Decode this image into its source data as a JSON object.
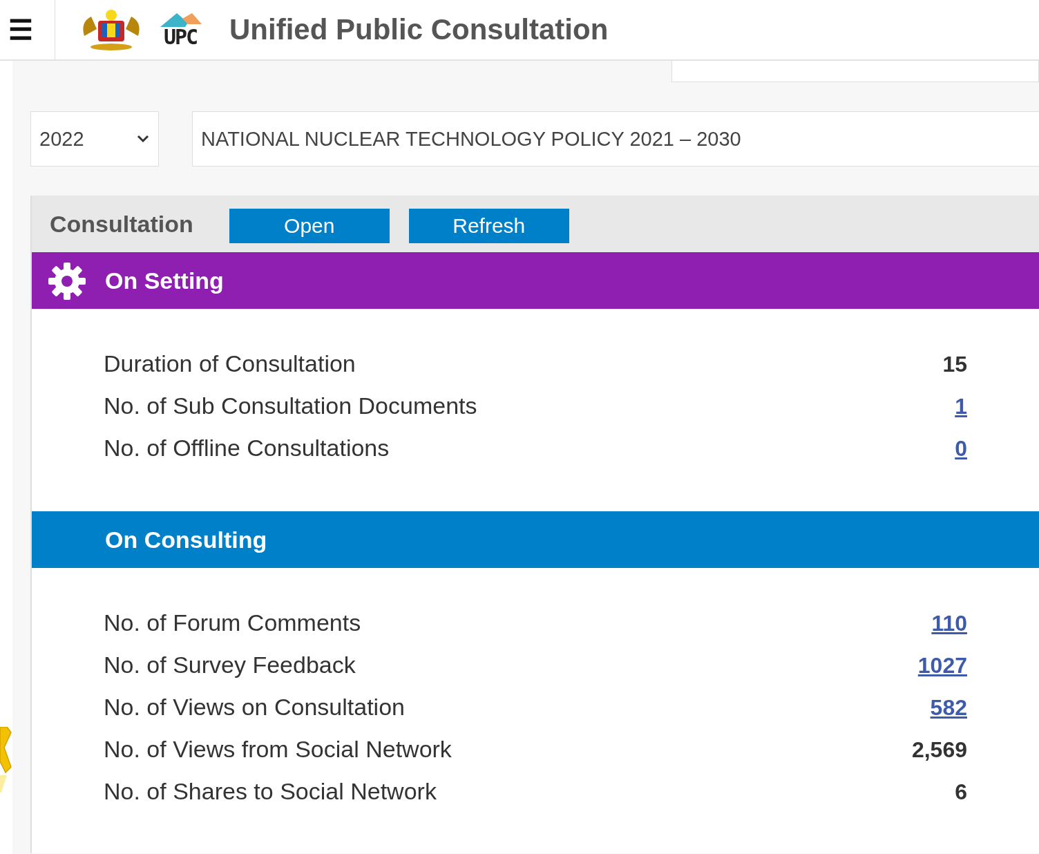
{
  "header": {
    "menu_glyph": "☰",
    "app_abbr": "UPC",
    "title": "Unified Public Consultation"
  },
  "filters": {
    "year": "2022",
    "policy": "NATIONAL NUCLEAR TECHNOLOGY POLICY 2021 – 2030"
  },
  "toolbar": {
    "label": "Consultation",
    "buttons": [
      "Open",
      "Refresh"
    ]
  },
  "sections": [
    {
      "title": "On Setting",
      "rows": [
        {
          "label": "Duration of Consultation",
          "value": "15",
          "kind": "plain"
        },
        {
          "label": "No. of Sub Consultation Documents",
          "value": "1",
          "kind": "link"
        },
        {
          "label": "No. of Offline Consultations",
          "value": "0",
          "kind": "link"
        }
      ]
    },
    {
      "title": "On Consulting",
      "rows": [
        {
          "label": "No. of Forum Comments",
          "value": "110",
          "kind": "link"
        },
        {
          "label": "No. of Survey Feedback",
          "value": "1027",
          "kind": "link"
        },
        {
          "label": "No. of Views on Consultation",
          "value": "582",
          "kind": "link"
        },
        {
          "label": "No. of Views from Social Network",
          "value": "2,569",
          "kind": "plain"
        },
        {
          "label": "No. of Shares to Social Network",
          "value": "6",
          "kind": "plain"
        }
      ]
    }
  ]
}
